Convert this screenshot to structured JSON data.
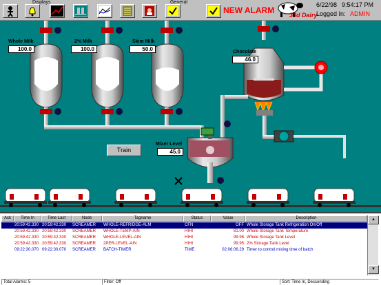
{
  "toolbar": {
    "displays_label": "Displays",
    "general_label": "General",
    "alarm_label": "NEW ALARM",
    "date": "6/22/98",
    "time": "9:54:17 PM",
    "logged_in_label": "Logged In:",
    "user": "ADMIN",
    "brand_text": "33d Dairy",
    "alarm_color": "#ff0000"
  },
  "process": {
    "background_color": "#008080",
    "tanks": [
      {
        "label": "Whole Milk",
        "value": "100.0"
      },
      {
        "label": "2% Milk",
        "value": "100.0"
      },
      {
        "label": "Skim Milk",
        "value": "50.0"
      }
    ],
    "chocolate": {
      "label": "Chocolate",
      "value": "46.0"
    },
    "mixer": {
      "label": "Mixer Level",
      "value": "45.0"
    },
    "train_button": "Train"
  },
  "alarm_table": {
    "columns": [
      "Ack",
      "Time In",
      "Time Last",
      "Node",
      "Tagname",
      "Status",
      "Value",
      "Description"
    ],
    "rows": [
      {
        "ack": "",
        "time_in": "20:59:42.330",
        "time_last": "20:59:42.330",
        "node": "SCREAMER",
        "tagname": "WHOLE-REFRIDGE-ALM",
        "status": "CFN",
        "value": "OFF",
        "description": "Whole Storage Tank Refrigeration On/Off",
        "style": "sel"
      },
      {
        "ack": "",
        "time_in": "20:59:42.330",
        "time_last": "20:59:42.330",
        "node": "SCREAMER",
        "tagname": "WHOLE-TEMP-AIN",
        "status": "HIHI",
        "value": "81.00",
        "description": "Whole Storage Tank Temperature",
        "style": "red"
      },
      {
        "ack": "",
        "time_in": "20:59:42.330",
        "time_last": "20:59:42.330",
        "node": "SCREAMER",
        "tagname": "WHOLE-LEVEL-AIN",
        "status": "HIHI",
        "value": "99.98",
        "description": "Whole Storage Tank Level",
        "style": "red"
      },
      {
        "ack": "",
        "time_in": "20:59:42.330",
        "time_last": "20:59:42.330",
        "node": "SCREAMER",
        "tagname": "2PER-LEVEL-AIN",
        "status": "HIHI",
        "value": "99.95",
        "description": "2% Storage Tank Level",
        "style": "red"
      },
      {
        "ack": "",
        "time_in": "09:22:30.070",
        "time_last": "09:22:30.070",
        "node": "SCREAMER",
        "tagname": "BATCH-TIMER",
        "status": "TIME",
        "value": "02:06:06.29",
        "description": "Timer to control mixing time of batch",
        "style": "blue"
      }
    ],
    "footer": {
      "total": "Total Alarms: 5",
      "filter": "Filter: Off",
      "sort": "Sort: Time In, Descending"
    }
  }
}
